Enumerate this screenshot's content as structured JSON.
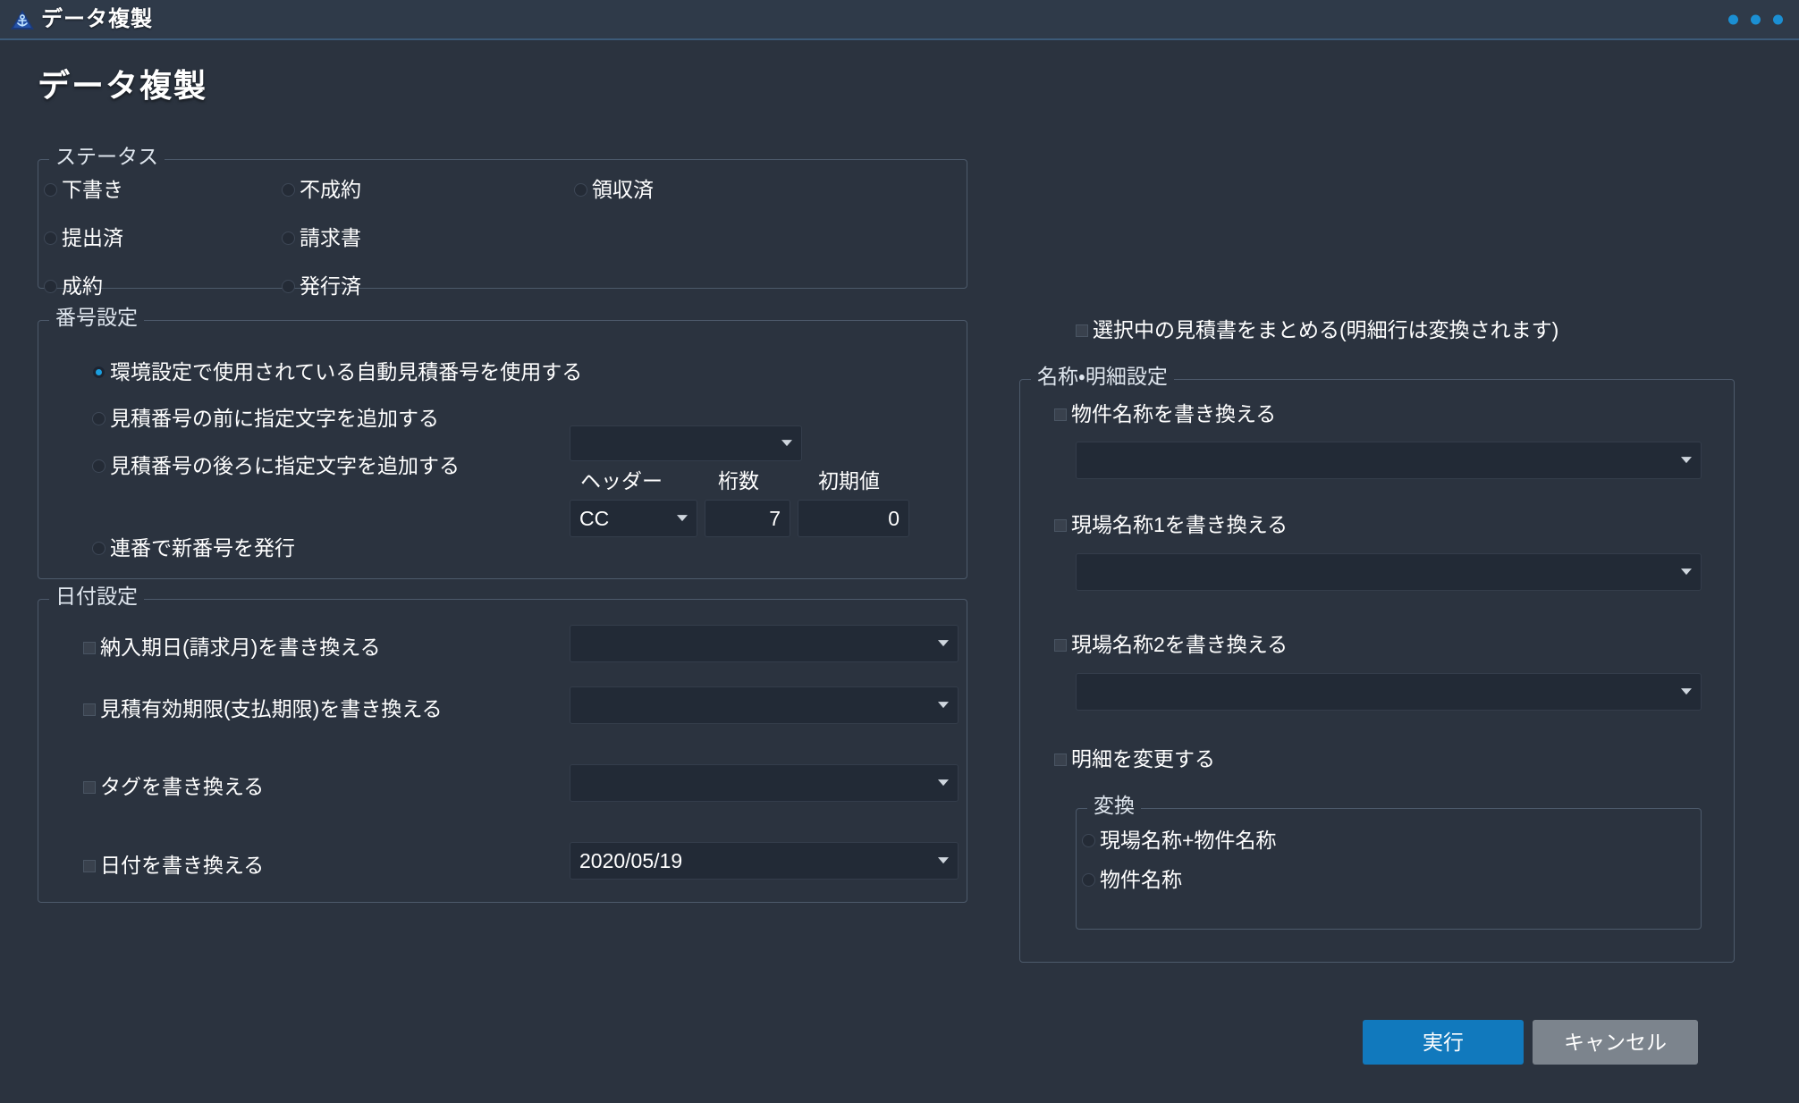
{
  "titlebar": {
    "title": "データ複製",
    "logo_icon": "anchor-triangle-logo-icon",
    "dots_icon": "three-dots-icon"
  },
  "page": {
    "heading": "データ複製"
  },
  "status_group": {
    "legend": "ステータス",
    "options": [
      {
        "label": "下書き",
        "selected": false
      },
      {
        "label": "不成約",
        "selected": false
      },
      {
        "label": "領収済",
        "selected": false
      },
      {
        "label": "提出済",
        "selected": false
      },
      {
        "label": "請求書",
        "selected": false
      },
      {
        "label": "成約",
        "selected": false
      },
      {
        "label": "発行済",
        "selected": false
      }
    ]
  },
  "number_group": {
    "legend": "番号設定",
    "options": [
      {
        "label": "環境設定で使用されている自動見積番号を使用する",
        "selected": true
      },
      {
        "label": "見積番号の前に指定文字を追加する",
        "selected": false
      },
      {
        "label": "見積番号の後ろに指定文字を追加する",
        "selected": false
      },
      {
        "label": "連番で新番号を発行",
        "selected": false
      }
    ],
    "suffix_select": {
      "value": "",
      "placeholder": ""
    },
    "serial_fields": {
      "header_caption": "ヘッダー",
      "header_value": "CC",
      "digits_caption": "桁数",
      "digits_value": "7",
      "initial_caption": "初期値",
      "initial_value": "0"
    }
  },
  "date_group": {
    "legend": "日付設定",
    "rows": [
      {
        "label": "納入期日(請求月)を書き換える",
        "checked": false,
        "control": "select",
        "value": ""
      },
      {
        "label": "見積有効期限(支払期限)を書き換える",
        "checked": false,
        "control": "select",
        "value": ""
      },
      {
        "label": "タグを書き換える",
        "checked": false,
        "control": "select",
        "value": ""
      },
      {
        "label": "日付を書き換える",
        "checked": false,
        "control": "select",
        "value": "2020/05/19"
      }
    ]
  },
  "merge_option": {
    "label": "選択中の見積書をまとめる(明細行は変換されます)",
    "checked": false
  },
  "name_group": {
    "legend": "名称・明細設定",
    "rows": [
      {
        "label": "物件名称を書き換える",
        "checked": false,
        "value": ""
      },
      {
        "label": "現場名称1を書き換える",
        "checked": false,
        "value": ""
      },
      {
        "label": "現場名称2を書き換える",
        "checked": false,
        "value": ""
      }
    ],
    "detail_change": {
      "label": "明細を変更する",
      "checked": false
    },
    "convert_group": {
      "legend": "変換",
      "options": [
        {
          "label": "現場名称+物件名称",
          "selected": false
        },
        {
          "label": "物件名称",
          "selected": false
        }
      ]
    }
  },
  "actions": {
    "execute_label": "実行",
    "cancel_label": "キャンセル"
  },
  "colors": {
    "accent": "#1b8fd3",
    "primary_button": "#1179bd",
    "secondary_button": "#7c848d",
    "background": "#2b333f",
    "titlebar": "#2f3a49",
    "input_background": "#222a36"
  }
}
